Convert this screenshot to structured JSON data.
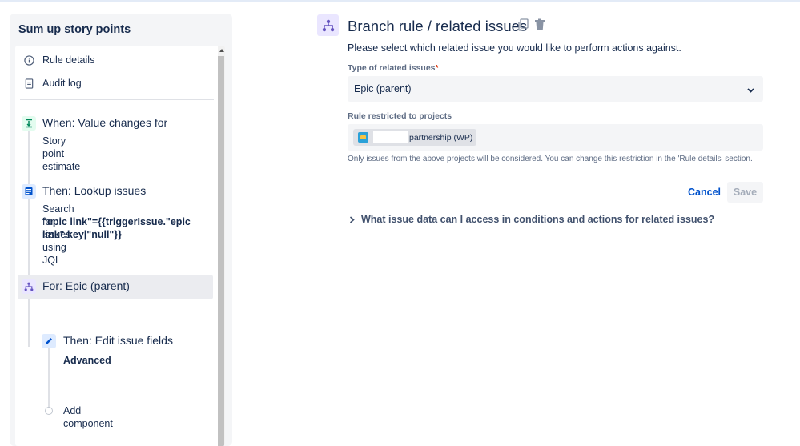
{
  "sidebar": {
    "title": "Sum up story points",
    "nav": [
      {
        "label": "Rule details",
        "icon": "info-icon"
      },
      {
        "label": "Audit log",
        "icon": "document-icon"
      }
    ],
    "steps": {
      "trigger": {
        "title": "When: Value changes for",
        "desc": "Story point estimate"
      },
      "lookup": {
        "title": "Then: Lookup issues",
        "desc": "Search for issues using JQL",
        "jql": "\"epic link\"={{triggerIssue.\"epic link\".key|\"null\"}}"
      },
      "branch": {
        "title": "For: Epic (parent)"
      },
      "edit": {
        "title": "Then: Edit issue fields",
        "desc": "Advanced"
      },
      "add": {
        "label": "Add component"
      }
    }
  },
  "main": {
    "title": "Branch rule / related issues",
    "subtitle": "Please select which related issue you would like to perform actions against.",
    "type_label": "Type of related issues",
    "type_required": "*",
    "type_value": "Epic (parent)",
    "projects_label": "Rule restricted to projects",
    "project_chip": "partnership (WP)",
    "helper": "Only issues from the above projects will be considered. You can change this restriction in the 'Rule details' section.",
    "cancel": "Cancel",
    "save": "Save",
    "expander": "What issue data can I access in conditions and actions for related issues?"
  },
  "colors": {
    "accent": "#0052cc",
    "branch_bg": "#eae6ff",
    "trigger_bg": "#e3fcef",
    "lookup_bg": "#deebff"
  }
}
